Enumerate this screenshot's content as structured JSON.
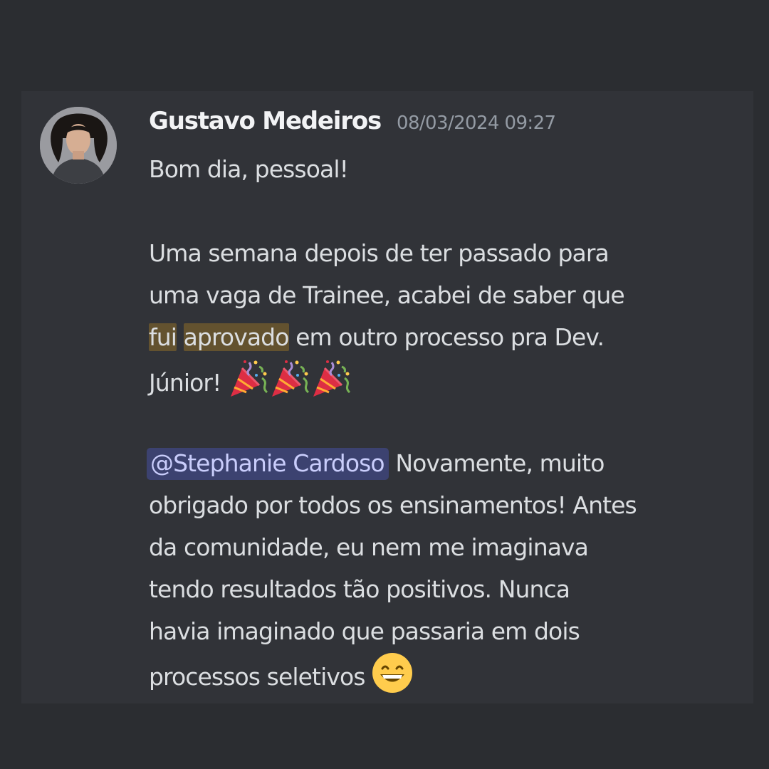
{
  "message": {
    "author": "Gustavo Medeiros",
    "timestamp": "08/03/2024 09:27",
    "greeting": "Bom dia, pessoal!",
    "para1": {
      "line1": "Uma semana depois de ter passado para",
      "line2": "uma vaga de Trainee, acabei de saber que",
      "hl_word1": "fui",
      "hl_word2": "aprovado",
      "line3_rest": " em outro processo pra Dev.",
      "line4": "Júnior! "
    },
    "para2": {
      "mention": "@Stephanie Cardoso",
      "line1_rest": " Novamente, muito",
      "line2": "obrigado por todos os ensinamentos! Antes",
      "line3": "da comunidade, eu nem me imaginava",
      "line4": "tendo resultados tão positivos. Nunca",
      "line5": "havia imaginado que passaria em dois",
      "line6": "processos seletivos "
    },
    "emojis": {
      "party": "party-popper-emoji",
      "grin": "grinning-face-emoji",
      "party_count": 3
    }
  },
  "colors": {
    "background": "#2b2d31",
    "message_panel": "#313338",
    "username": "#f2f3f5",
    "timestamp": "#949ba4",
    "text": "#dbdee1",
    "highlight": "#63522f",
    "mention_bg": "#3c4270",
    "mention_text": "#c9cdfb"
  }
}
